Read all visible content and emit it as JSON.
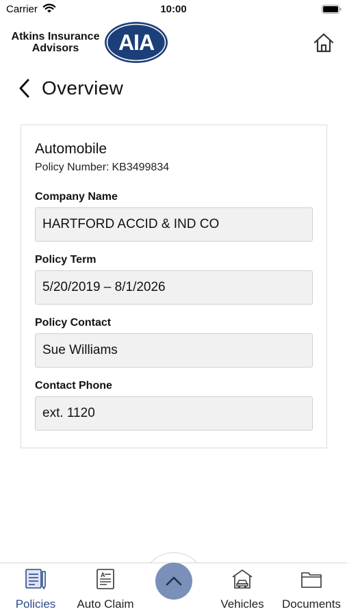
{
  "status_bar": {
    "carrier": "Carrier",
    "time": "10:00"
  },
  "header": {
    "brand_line1": "Atkins Insurance",
    "brand_line2": "Advisors",
    "logo_text": "AIA",
    "logo_color": "#1c3f7a"
  },
  "page": {
    "title": "Overview"
  },
  "policy": {
    "type": "Automobile",
    "number_label": "Policy Number:",
    "number": "KB3499834",
    "fields": [
      {
        "label": "Company Name",
        "value": "HARTFORD ACCID & IND CO"
      },
      {
        "label": "Policy Term",
        "value": "5/20/2019 – 8/1/2026"
      },
      {
        "label": "Policy Contact",
        "value": "Sue Williams"
      },
      {
        "label": "Contact Phone",
        "value": "ext. 1120"
      }
    ]
  },
  "tab_bar": {
    "active_color": "#2a4a8c",
    "accent_button_color": "#7b90b8",
    "tabs": [
      {
        "label": "Policies",
        "icon": "policies-document-icon",
        "active": true
      },
      {
        "label": "Auto Claim",
        "icon": "auto-claim-form-icon",
        "active": false
      },
      {
        "label": "Vehicles",
        "icon": "vehicle-garage-icon",
        "active": false
      },
      {
        "label": "Documents",
        "icon": "documents-folder-icon",
        "active": false
      }
    ],
    "center_button_icon": "chevron-up-icon"
  }
}
